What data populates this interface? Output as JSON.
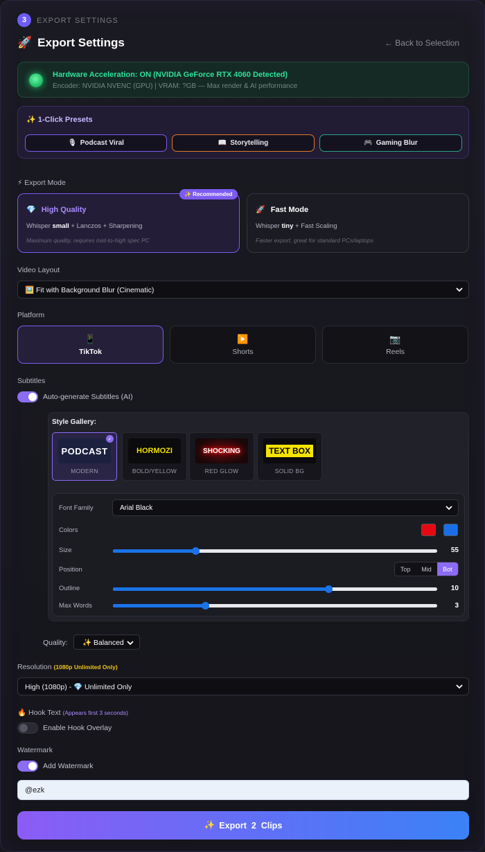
{
  "step": {
    "number": "3",
    "label": "EXPORT SETTINGS"
  },
  "header": {
    "icon": "🚀",
    "title": "Export Settings",
    "back": "← Back to Selection"
  },
  "hardware": {
    "title": "Hardware Acceleration: ON (NVIDIA GeForce RTX 4060 Detected)",
    "subtitle": "Encoder: NVIDIA NVENC (GPU) | VRAM: ?GB — Max render & AI performance",
    "status_color": "#22c26b"
  },
  "presets": {
    "title": "✨ 1-Click Presets",
    "items": [
      {
        "icon": "🎙",
        "label": "Podcast Viral"
      },
      {
        "icon": "📖",
        "label": "Storytelling"
      },
      {
        "icon": "🎮",
        "label": "Gaming Blur"
      }
    ]
  },
  "export_mode": {
    "label": "⚡ Export Mode",
    "recommended_badge": "✨ Recommended",
    "high": {
      "icon": "💎",
      "title": "High Quality",
      "sub_prefix": "Whisper",
      "sub_bold": "small",
      "sub_suffix": "+ Lanczos + Sharpening",
      "note": "Maximum quality, requires mid-to-high spec PC",
      "selected": true
    },
    "fast": {
      "icon": "🚀",
      "title": "Fast Mode",
      "sub_prefix": "Whisper",
      "sub_bold": "tiny",
      "sub_suffix": "+ Fast Scaling",
      "note": "Faster export, great for standard PCs/laptops"
    }
  },
  "video_layout": {
    "label": "Video Layout",
    "value": "🖼️ Fit with Background Blur (Cinematic)"
  },
  "platform": {
    "label": "Platform",
    "items": [
      {
        "icon": "📱",
        "label": "TikTok",
        "active": true
      },
      {
        "icon": "▶️",
        "label": "Shorts"
      },
      {
        "icon": "📷",
        "label": "Reels"
      }
    ]
  },
  "subtitles": {
    "label": "Subtitles",
    "toggle_label": "Auto-generate Subtitles (AI)",
    "enabled": true,
    "gallery_title": "Style Gallery:",
    "styles": [
      {
        "preview": "PODCAST",
        "caption": "MODERN",
        "selected": true
      },
      {
        "preview": "HORMOZI",
        "caption": "BOLD/YELLOW"
      },
      {
        "preview": "SHOCKING",
        "caption": "RED GLOW"
      },
      {
        "preview": "TEXT BOX",
        "caption": "SOLID BG"
      }
    ],
    "font_family": {
      "label": "Font Family",
      "value": "Arial Black"
    },
    "colors": {
      "label": "Colors",
      "primary": "#e50914",
      "secondary": "#1a6fe8"
    },
    "size": {
      "label": "Size",
      "value": "55",
      "fraction": 0.255
    },
    "position": {
      "label": "Position",
      "options": [
        "Top",
        "Mid",
        "Bot"
      ],
      "selected": "Bot"
    },
    "outline": {
      "label": "Outline",
      "value": "10",
      "fraction": 0.665
    },
    "max_words": {
      "label": "Max Words",
      "value": "3",
      "fraction": 0.285
    }
  },
  "quality": {
    "label": "Quality:",
    "value": "✨ Balanced"
  },
  "resolution": {
    "label": "Resolution",
    "note": "(1080p Unlimited Only)",
    "value": "High (1080p) - 💎 Unlimited Only"
  },
  "hook": {
    "icon": "🔥",
    "label": "Hook Text",
    "note": "(Appears first 3 seconds)",
    "toggle_label": "Enable Hook Overlay",
    "enabled": false
  },
  "watermark": {
    "label": "Watermark",
    "toggle_label": "Add Watermark",
    "enabled": true,
    "value": "@ezk"
  },
  "export": {
    "icon": "✨",
    "label": "Export  2  Clips"
  }
}
